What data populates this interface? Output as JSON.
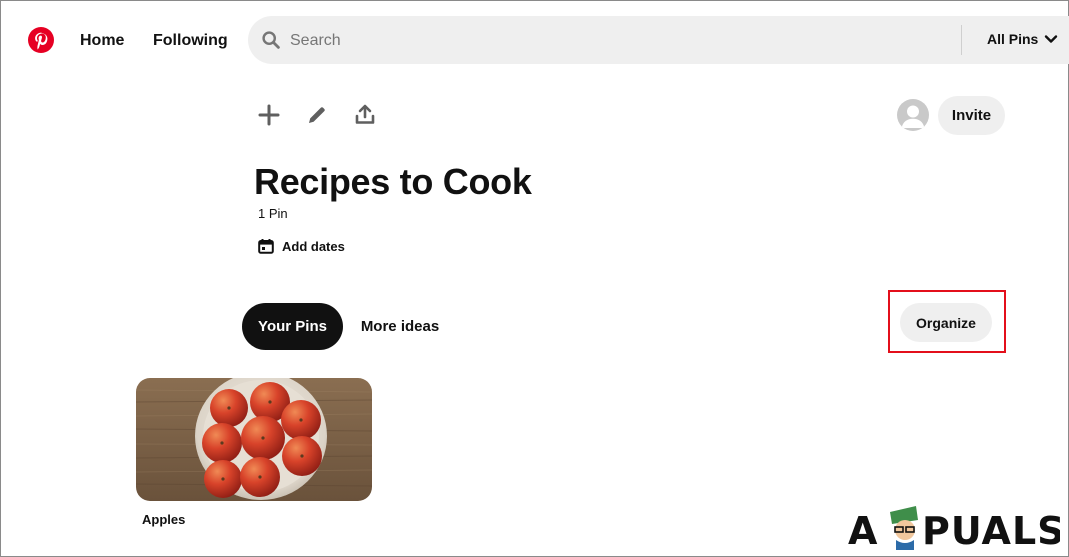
{
  "nav": {
    "home": "Home",
    "following": "Following"
  },
  "search": {
    "placeholder": "Search",
    "value": "",
    "filter": "All Pins"
  },
  "board": {
    "invite_label": "Invite",
    "title": "Recipes to Cook",
    "pin_count": "1 Pin",
    "add_dates": "Add dates"
  },
  "tabs": [
    {
      "label": "Your Pins",
      "active": true
    },
    {
      "label": "More ideas",
      "active": false
    }
  ],
  "organize": {
    "label": "Organize",
    "highlight_color": "#e30f1b"
  },
  "pins": [
    {
      "title": "Apples"
    }
  ],
  "watermark": {
    "left": "A",
    "right": "PUALS"
  },
  "colors": {
    "brand": "#e60023",
    "active_tab": "#111111",
    "pill_bg": "#efefef"
  },
  "icons": {
    "logo": "pinterest-logo-icon",
    "search": "search-icon",
    "filter": "chevron-down-icon",
    "add": "plus-icon",
    "edit": "pencil-icon",
    "share": "share-icon",
    "avatar": "user-avatar-icon",
    "dates": "calendar-icon"
  }
}
